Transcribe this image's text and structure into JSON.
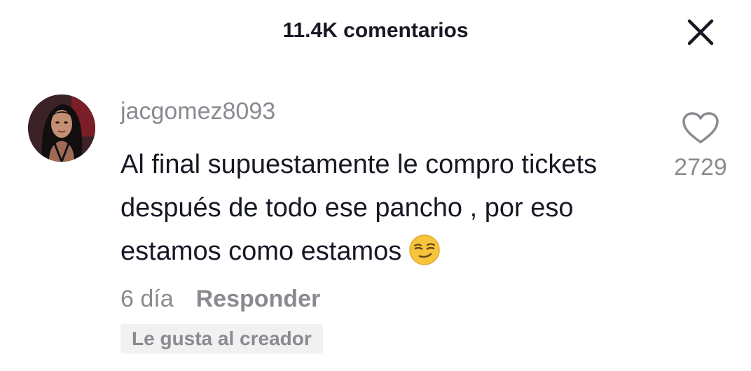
{
  "header": {
    "title": "11.4K comentarios",
    "close_icon": "close-icon"
  },
  "comment": {
    "avatar_icon": "user-avatar",
    "username": "jacgomez8093",
    "text": "Al final supuestamente le compro tickets después de todo ese pancho , por eso estamos como estamos",
    "emoji_icon": "smirking-face-emoji",
    "time": "6 día",
    "reply_label": "Responder",
    "creator_badge": "Le gusta al creador",
    "like_icon": "heart-outline-icon",
    "like_count": "2729"
  },
  "colors": {
    "primary_text": "#161823",
    "secondary_text": "#8a8b91",
    "badge_background": "#f1f1f2",
    "background": "#ffffff"
  }
}
